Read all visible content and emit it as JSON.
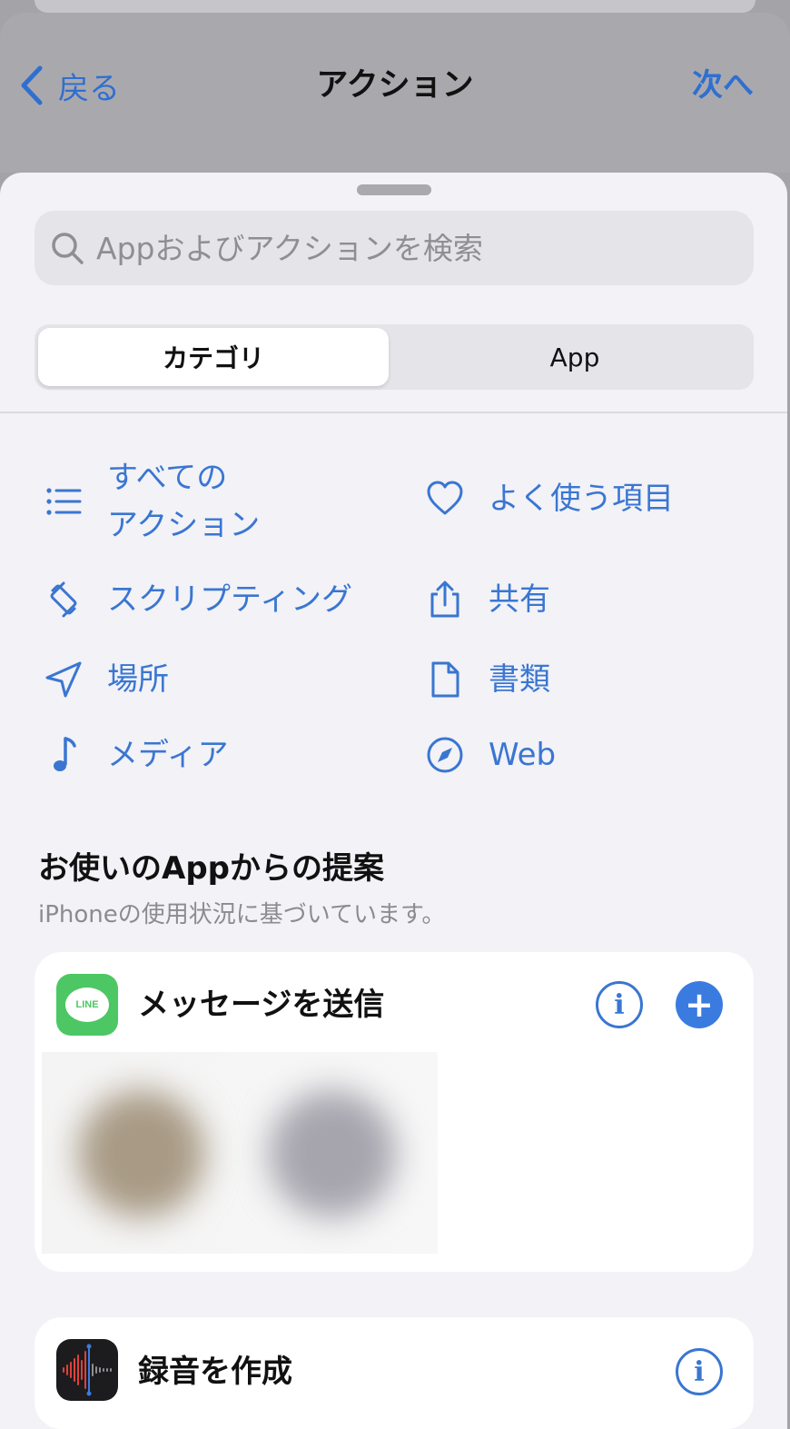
{
  "nav": {
    "back_label": "戻る",
    "title": "アクション",
    "next_label": "次へ"
  },
  "search": {
    "placeholder": "Appおよびアクションを検索"
  },
  "segments": {
    "category": "カテゴリ",
    "app": "App",
    "selected": "カテゴリ"
  },
  "categories": [
    {
      "label_line1": "すべての",
      "label_line2": "アクション",
      "icon": "list-icon"
    },
    {
      "label": "よく使う項目",
      "icon": "heart-icon"
    },
    {
      "label": "スクリプティング",
      "icon": "scripting-icon"
    },
    {
      "label": "共有",
      "icon": "share-icon"
    },
    {
      "label": "場所",
      "icon": "location-arrow-icon"
    },
    {
      "label": "書類",
      "icon": "document-icon"
    },
    {
      "label": "メディア",
      "icon": "music-note-icon"
    },
    {
      "label": "Web",
      "icon": "compass-icon"
    }
  ],
  "suggestions": {
    "title": "お使いのAppからの提案",
    "subtitle": "iPhoneの使用状況に基づいています。",
    "items": [
      {
        "title": "メッセージを送信",
        "app_icon": "line-app-icon",
        "app_icon_text": "LINE"
      },
      {
        "title": "録音を作成",
        "app_icon": "voice-memos-app-icon"
      }
    ]
  },
  "colors": {
    "accent": "#3a76d1",
    "line_green": "#4cc764",
    "sheet_bg": "#f2f2f7"
  }
}
